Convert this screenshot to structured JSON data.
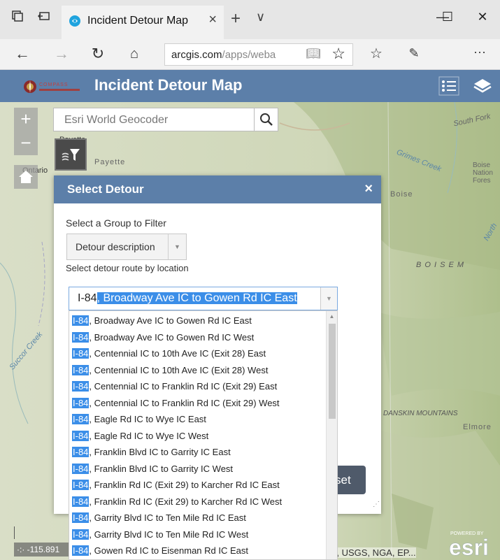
{
  "browser": {
    "tab_title": "Incident Detour Map",
    "tab_close": "×",
    "new_tab": "+",
    "tab_menu": "∨",
    "minimize": "—",
    "maximize": "☐",
    "close": "✕",
    "url_domain": "arcgis.com",
    "url_rest": "/apps/weba",
    "more": "···"
  },
  "app": {
    "title": "Incident Detour Map",
    "logo_text": "COMPASS"
  },
  "map": {
    "zoom_in": "+",
    "zoom_out": "−",
    "search_placeholder": "Esri World Geocoder",
    "coordinates": "-115.891",
    "attribution": "D, USGS, NGA, EP...",
    "labels": {
      "payette_bold": "Payette",
      "payette": "Payette",
      "ontario": "Ontario",
      "boise": "Boise",
      "boise_mountains": "B O I S E   M",
      "boise_national_forest": "Boise Nation Fores",
      "south_fork": "South Fork",
      "grimes_creek": "Grimes Creek",
      "succor_creek": "Succor Creek",
      "danskin_mountains": "DANSKIN MOUNTAINS",
      "elmore": "Elmore",
      "north": "North"
    },
    "powered_by": "POWERED BY",
    "esri": "esri"
  },
  "dialog": {
    "title": "Select Detour",
    "close": "×",
    "group_label": "Select a Group to Filter",
    "group_value": "Detour description",
    "route_label": "Select detour route by location",
    "reset_label": "set",
    "combo_prefix": "I-84",
    "combo_selected": ", Broadway Ave IC to Gowen Rd IC East",
    "options": [
      {
        "hl": "I-84",
        "rest": ", Broadway Ave IC to Gowen Rd IC East"
      },
      {
        "hl": "I-84",
        "rest": ", Broadway Ave IC to Gowen Rd IC West"
      },
      {
        "hl": "I-84",
        "rest": ", Centennial IC to 10th Ave IC (Exit 28) East"
      },
      {
        "hl": "I-84",
        "rest": ", Centennial IC to 10th Ave IC (Exit 28) West"
      },
      {
        "hl": "I-84",
        "rest": ", Centennial IC to Franklin Rd IC (Exit 29) East"
      },
      {
        "hl": "I-84",
        "rest": ", Centennial IC to Franklin Rd IC (Exit 29) West"
      },
      {
        "hl": "I-84",
        "rest": ", Eagle Rd IC to Wye IC East"
      },
      {
        "hl": "I-84",
        "rest": ", Eagle Rd IC to Wye IC West"
      },
      {
        "hl": "I-84",
        "rest": ", Franklin Blvd IC to Garrity IC East"
      },
      {
        "hl": "I-84",
        "rest": ", Franklin Blvd IC to Garrity IC West"
      },
      {
        "hl": "I-84",
        "rest": ", Franklin Rd IC (Exit 29) to Karcher Rd IC East"
      },
      {
        "hl": "I-84",
        "rest": ", Franklin Rd IC (Exit 29) to Karcher Rd IC West"
      },
      {
        "hl": "I-84",
        "rest": ", Garrity Blvd IC to Ten Mile Rd IC East"
      },
      {
        "hl": "I-84",
        "rest": ", Garrity Blvd IC to Ten Mile Rd IC West"
      },
      {
        "hl": "I-84",
        "rest": ", Gowen Rd IC to Eisenman Rd IC East"
      }
    ]
  },
  "colors": {
    "header_blue": "#5c7fa9",
    "selection_blue": "#3b8ee8",
    "reset_button": "#4f5a6a"
  }
}
